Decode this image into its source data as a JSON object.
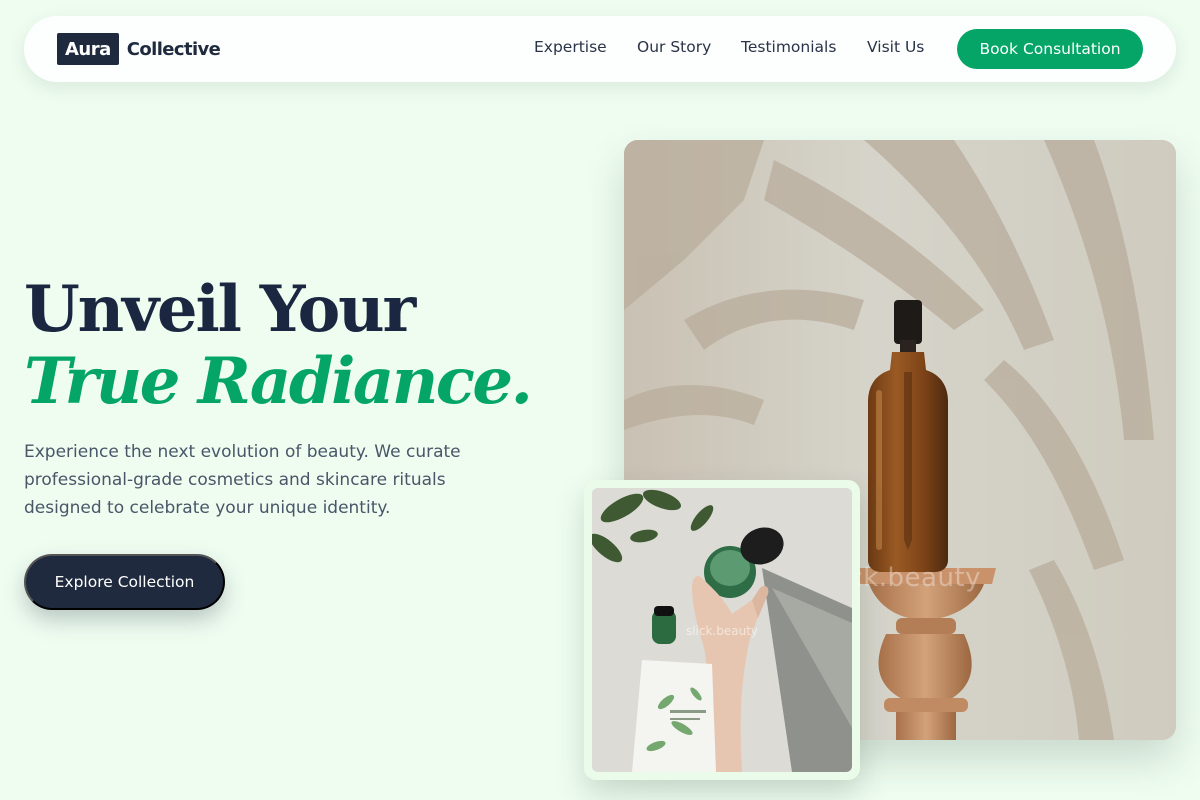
{
  "nav": {
    "logo_box": "Aura",
    "logo_word": "Collective",
    "links": [
      "Expertise",
      "Our Story",
      "Testimonials",
      "Visit Us"
    ],
    "cta": "Book Consultation"
  },
  "hero": {
    "title_line1": "Unveil Your",
    "title_line2": "True Radiance.",
    "description": "Experience the next evolution of beauty. We curate professional-grade cosmetics and skincare rituals designed to celebrate your unique identity.",
    "button": "Explore Collection"
  },
  "images": {
    "main_watermark": "slick.beauty",
    "small_watermark": "slick.beauty"
  },
  "colors": {
    "background": "#effdf1",
    "brand_dark": "#1f2a3e",
    "accent_green": "#04a566"
  }
}
